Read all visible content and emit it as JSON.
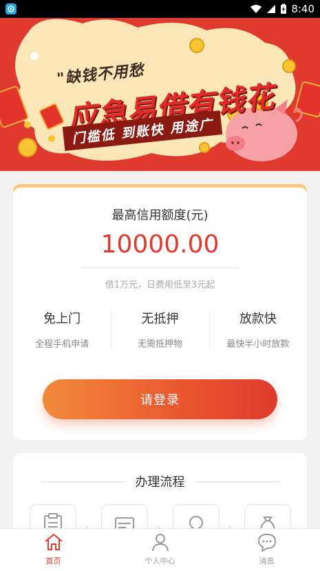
{
  "status_bar": {
    "time": "8:40"
  },
  "banner": {
    "slogan_small": "\"缺钱不用愁",
    "slogan_big": "应急易借有钱花",
    "slogan_tags": "门槛低 到账快 用途广"
  },
  "credit": {
    "title": "最高信用额度(元)",
    "amount": "10000.00",
    "note": "借1万元，日费用低至3元起"
  },
  "features": [
    {
      "title": "免上门",
      "desc": "全程手机申请"
    },
    {
      "title": "无抵押",
      "desc": "无需抵押物"
    },
    {
      "title": "放款快",
      "desc": "最快半小时放款"
    }
  ],
  "login_button": "请登录",
  "process": {
    "title": "办理流程"
  },
  "nav": [
    {
      "label": "首页",
      "icon": "home-icon",
      "active": true
    },
    {
      "label": "个人中心",
      "icon": "person-icon",
      "active": false
    },
    {
      "label": "消息",
      "icon": "message-icon",
      "active": false
    }
  ],
  "colors": {
    "accent": "#e0392e",
    "button_start": "#f08a3a",
    "button_end": "#df3b2c",
    "card_strip": "#f8c77b"
  }
}
